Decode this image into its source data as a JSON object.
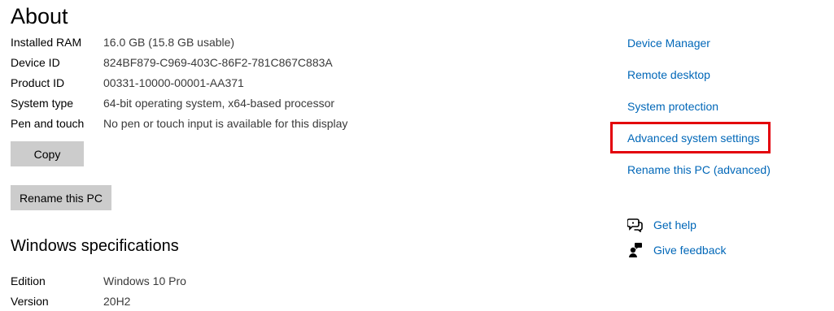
{
  "page": {
    "title": "About"
  },
  "device_specs": [
    {
      "label": "Installed RAM",
      "value": "16.0 GB (15.8 GB usable)"
    },
    {
      "label": "Device ID",
      "value": "824BF879-C969-403C-86F2-781C867C883A"
    },
    {
      "label": "Product ID",
      "value": "00331-10000-00001-AA371"
    },
    {
      "label": "System type",
      "value": "64-bit operating system, x64-based processor"
    },
    {
      "label": "Pen and touch",
      "value": "No pen or touch input is available for this display"
    }
  ],
  "buttons": {
    "copy": "Copy",
    "rename": "Rename this PC"
  },
  "windows_specs": {
    "title": "Windows specifications",
    "rows": [
      {
        "label": "Edition",
        "value": "Windows 10 Pro"
      },
      {
        "label": "Version",
        "value": "20H2"
      }
    ]
  },
  "related_links": [
    "Device Manager",
    "Remote desktop",
    "System protection",
    "Advanced system settings",
    "Rename this PC (advanced)"
  ],
  "highlighted_link": "Advanced system settings",
  "help": {
    "get_help": "Get help",
    "give_feedback": "Give feedback"
  },
  "colors": {
    "link": "#0067b8",
    "highlight": "#e3000b",
    "button_bg": "#cccccc"
  },
  "icons": {
    "get_help": "chat-help-icon",
    "give_feedback": "feedback-person-icon"
  }
}
